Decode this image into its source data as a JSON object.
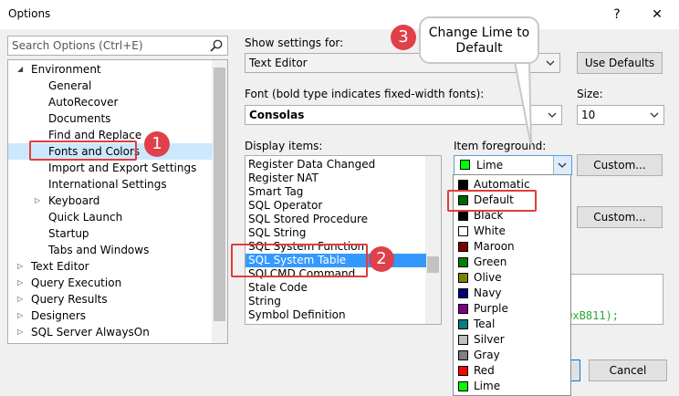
{
  "window": {
    "title": "Options",
    "help_glyph": "?",
    "close_glyph": "✕"
  },
  "search": {
    "placeholder": "Search Options (Ctrl+E)"
  },
  "tree": {
    "items": [
      {
        "label": "Environment",
        "level": 0,
        "state": "expanded"
      },
      {
        "label": "General",
        "level": 1
      },
      {
        "label": "AutoRecover",
        "level": 1
      },
      {
        "label": "Documents",
        "level": 1
      },
      {
        "label": "Find and Replace",
        "level": 1
      },
      {
        "label": "Fonts and Colors",
        "level": 1,
        "selected": true
      },
      {
        "label": "Import and Export Settings",
        "level": 1
      },
      {
        "label": "International Settings",
        "level": 1
      },
      {
        "label": "Keyboard",
        "level": 1,
        "state": "collapsed"
      },
      {
        "label": "Quick Launch",
        "level": 1
      },
      {
        "label": "Startup",
        "level": 1
      },
      {
        "label": "Tabs and Windows",
        "level": 1
      },
      {
        "label": "Text Editor",
        "level": 0,
        "state": "collapsed"
      },
      {
        "label": "Query Execution",
        "level": 0,
        "state": "collapsed"
      },
      {
        "label": "Query Results",
        "level": 0,
        "state": "collapsed"
      },
      {
        "label": "Designers",
        "level": 0,
        "state": "collapsed"
      },
      {
        "label": "SQL Server AlwaysOn",
        "level": 0,
        "state": "collapsed"
      }
    ]
  },
  "show_settings": {
    "label": "Show settings for:",
    "value": "Text Editor",
    "use_defaults": "Use Defaults"
  },
  "font": {
    "label": "Font (bold type indicates fixed-width fonts):",
    "value": "Consolas"
  },
  "size": {
    "label": "Size:",
    "value": "10"
  },
  "display_items": {
    "label": "Display items:",
    "items": [
      {
        "label": "Register Data Changed"
      },
      {
        "label": "Register NAT"
      },
      {
        "label": "Smart Tag"
      },
      {
        "label": "SQL Operator"
      },
      {
        "label": "SQL Stored Procedure"
      },
      {
        "label": "SQL String"
      },
      {
        "label": "SQL System Function"
      },
      {
        "label": "SQL System Table",
        "selected": true
      },
      {
        "label": "SQLCMD Command"
      },
      {
        "label": "Stale Code"
      },
      {
        "label": "String"
      },
      {
        "label": "Symbol Definition"
      }
    ]
  },
  "item_foreground": {
    "label": "Item foreground:",
    "value": "Lime",
    "value_color": "#00ff00",
    "custom": "Custom..."
  },
  "item_background": {
    "custom": "Custom..."
  },
  "color_options": [
    {
      "label": "Automatic",
      "color": "#000000"
    },
    {
      "label": "Default",
      "color": "#006400"
    },
    {
      "label": "Black",
      "color": "#000000"
    },
    {
      "label": "White",
      "color": "#ffffff"
    },
    {
      "label": "Maroon",
      "color": "#800000"
    },
    {
      "label": "Green",
      "color": "#008000"
    },
    {
      "label": "Olive",
      "color": "#808000"
    },
    {
      "label": "Navy",
      "color": "#000080"
    },
    {
      "label": "Purple",
      "color": "#800080"
    },
    {
      "label": "Teal",
      "color": "#008080"
    },
    {
      "label": "Silver",
      "color": "#c0c0c0"
    },
    {
      "label": "Gray",
      "color": "#808080"
    },
    {
      "label": "Red",
      "color": "#ff0000"
    },
    {
      "label": "Lime",
      "color": "#00ff00"
    }
  ],
  "preview": {
    "sample": "0xB811);"
  },
  "footer": {
    "cancel": "Cancel"
  },
  "annotations": {
    "step1": "1",
    "step2": "2",
    "step3": "3",
    "callout": "Change Lime to Default"
  },
  "colors": {
    "accent": "#3399ff",
    "annotation_red": "#e03c3c",
    "tree_selection": "#cce8ff"
  }
}
